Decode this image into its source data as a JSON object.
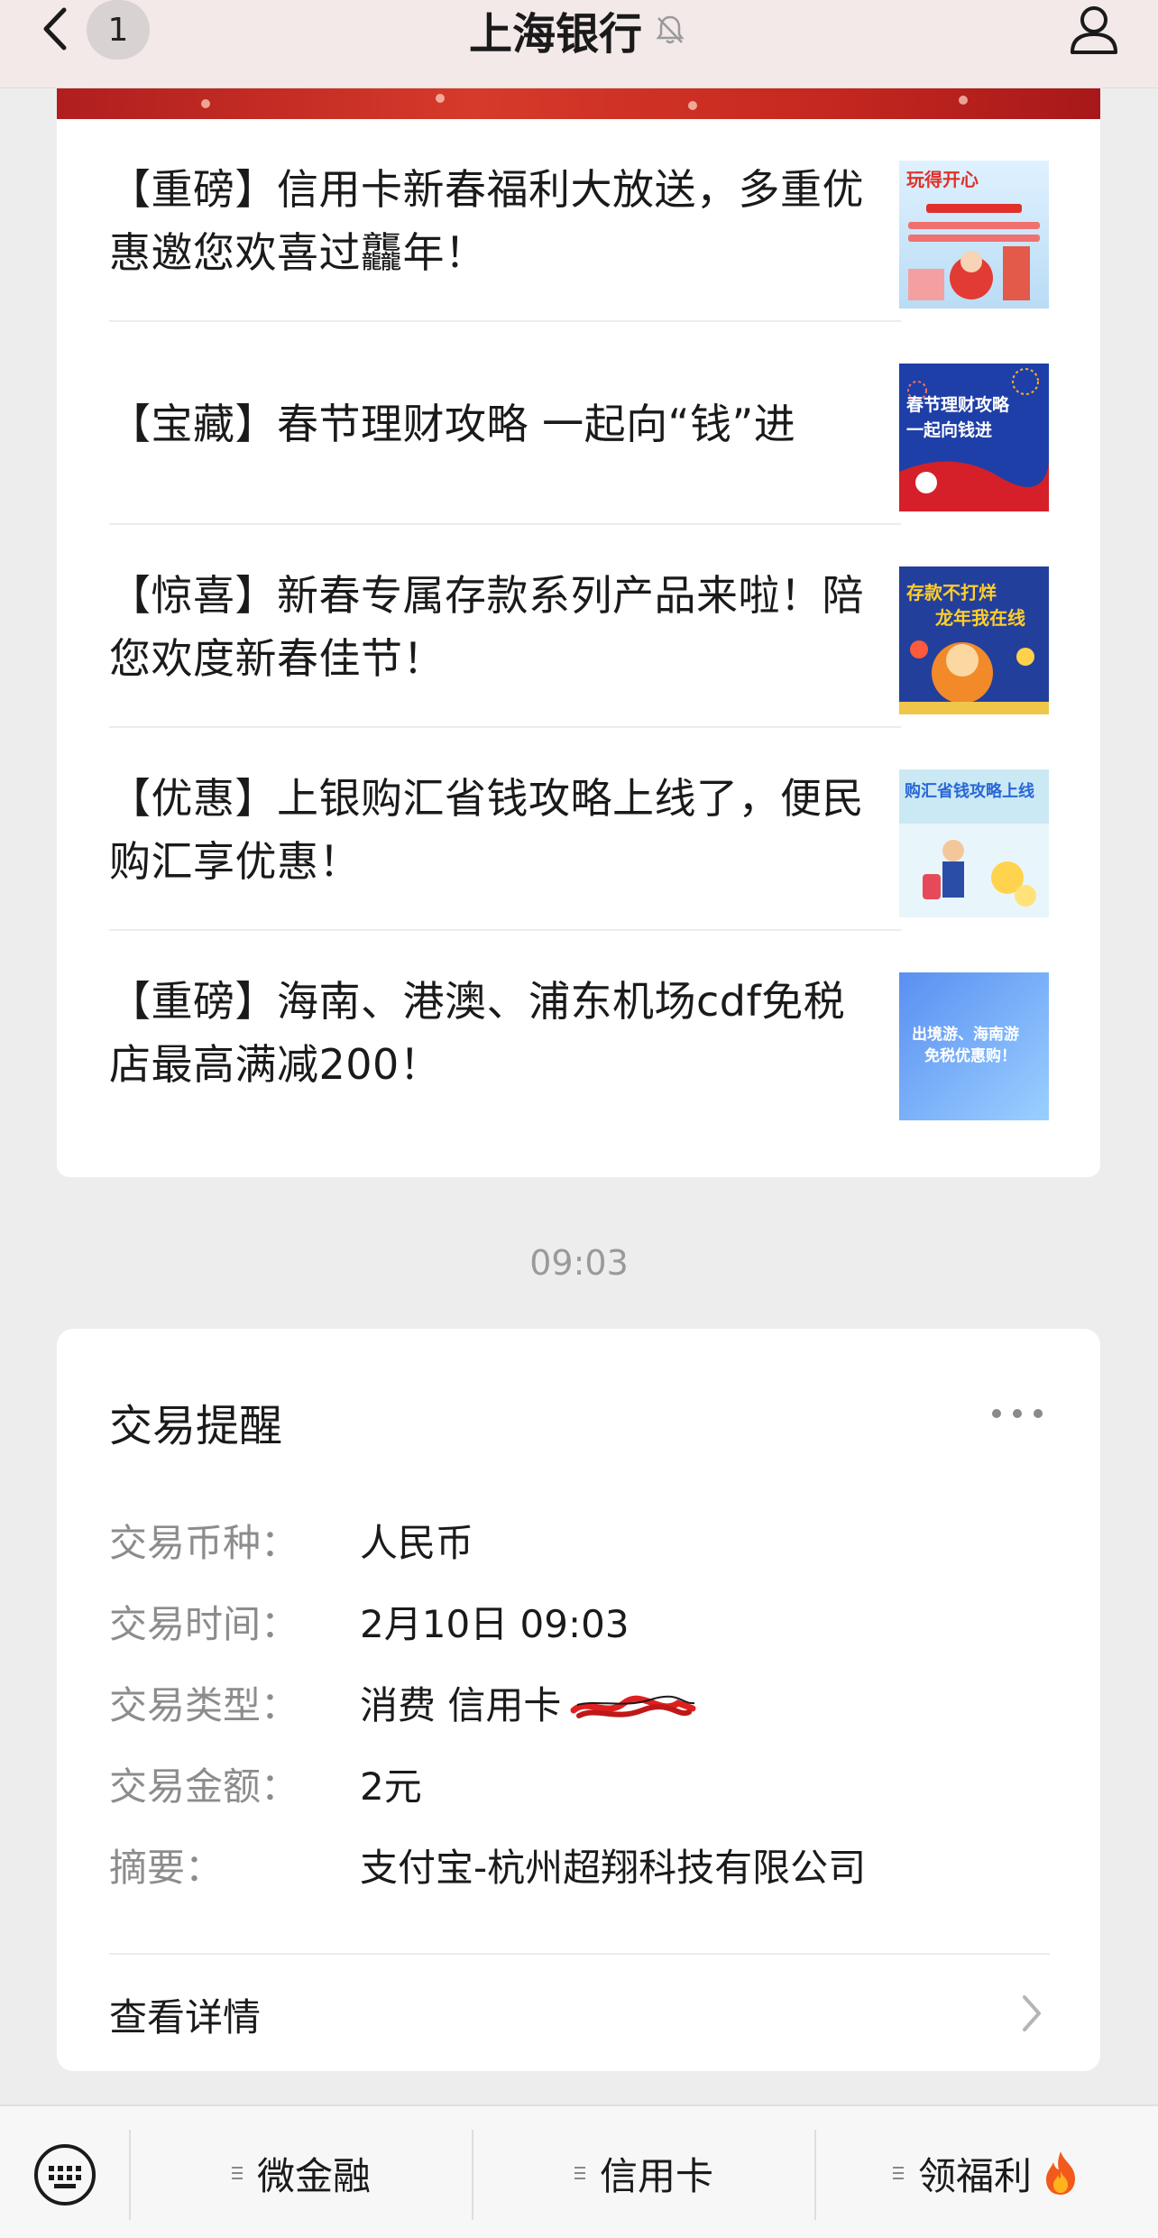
{
  "header": {
    "title": "上海银行",
    "unread_count": "1",
    "back_icon": "chevron-left-icon",
    "mute_icon": "bell-off-icon",
    "profile_icon": "person-icon"
  },
  "articles": [
    {
      "text": "【重磅】信用卡新春福利大放送，多重优惠邀您欢喜过龘年！",
      "thumb_text": "玩得开心 看个过瘾"
    },
    {
      "text": "【宝藏】春节理财攻略 一起向“钱”进",
      "thumb_text": "春节理财攻略 一起向“钱”进"
    },
    {
      "text": "【惊喜】新春专属存款系列产品来啦！陪您欢度新春佳节！",
      "thumb_text": "存款不打烊 龙年我在线"
    },
    {
      "text": "【优惠】上银购汇省钱攻略上线了，便民购汇享优惠！",
      "thumb_text": "购汇省钱攻略上线"
    },
    {
      "text": "【重磅】海南、港澳、浦东机场cdf免税店最高满减200！",
      "thumb_text": "出境游、海南游 免税优惠购！"
    }
  ],
  "timestamp": "09:03",
  "transaction": {
    "title": "交易提醒",
    "rows": [
      {
        "label": "交易币种：",
        "value": "人民币"
      },
      {
        "label": "交易时间：",
        "value": "2月10日 09:03"
      },
      {
        "label": "交易类型：",
        "value": "消费 信用卡"
      },
      {
        "label": "交易金额：",
        "value": "2元"
      },
      {
        "label": "摘要：",
        "value": "支付宝-杭州超翔科技有限公司"
      }
    ],
    "detail_label": "查看详情"
  },
  "bottom_menu": {
    "items": [
      "微金融",
      "信用卡",
      "领福利"
    ],
    "keyboard_icon": "keyboard-icon",
    "hot_icon": "fire-icon"
  },
  "colors": {
    "header_bg": "#f3e9e9",
    "page_bg": "#ededed",
    "banner_red": "#c82a20",
    "label_gray": "#8c8c8c"
  }
}
